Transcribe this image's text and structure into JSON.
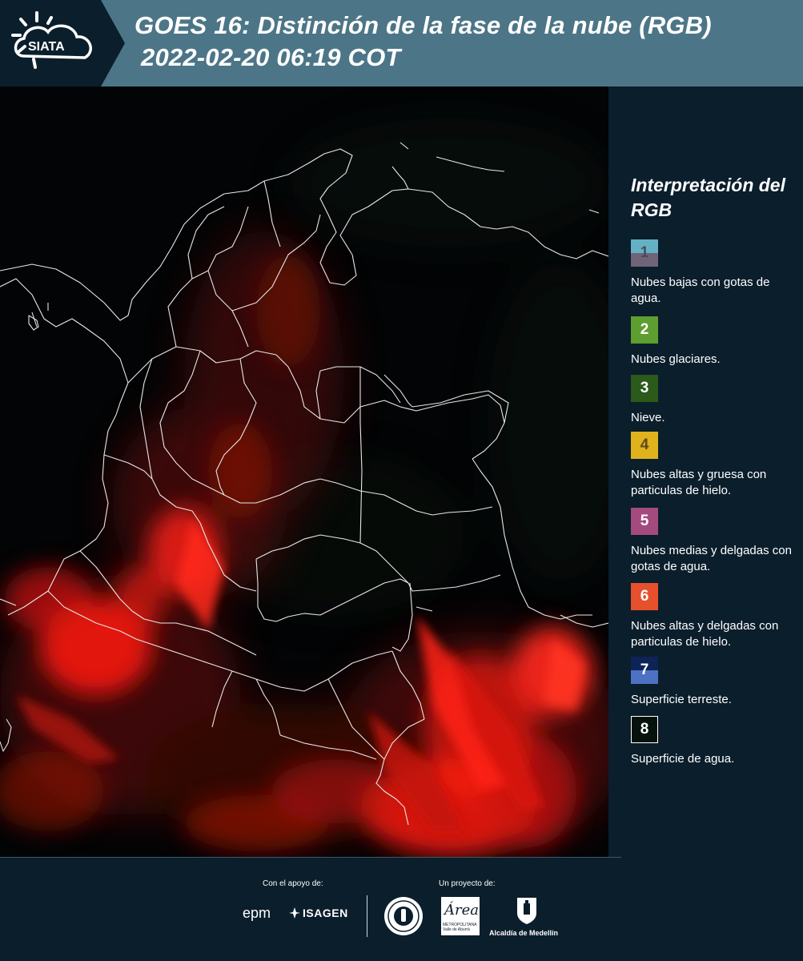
{
  "header": {
    "brand": "SIATA",
    "title_line1": "GOES 16: Distinción de la fase de la nube (RGB)",
    "title_line2": "2022-02-20 06:19 COT"
  },
  "legend": {
    "title": "Interpretación del RGB",
    "items": [
      {
        "number": "1",
        "label": "Nubes bajas con gotas de agua.",
        "color_top": "#62b2c4",
        "color_bottom": "#6f6478",
        "text_color": "#4b4b5a"
      },
      {
        "number": "2",
        "label": "Nubes glaciares.",
        "color_top": "#5e9d2f",
        "color_bottom": "#5e9d2f",
        "text_color": "#ffffff"
      },
      {
        "number": "3",
        "label": "Nieve.",
        "color_top": "#2b5a1b",
        "color_bottom": "#2b5a1b",
        "text_color": "#ffffff"
      },
      {
        "number": "4",
        "label": "Nubes altas y gruesa con particulas de hielo.",
        "color_top": "#e0b21c",
        "color_bottom": "#e0b21c",
        "text_color": "#5b4a20"
      },
      {
        "number": "5",
        "label": "Nubes medias y delgadas con gotas de agua.",
        "color_top": "#a34b7f",
        "color_bottom": "#a34b7f",
        "text_color": "#ffffff"
      },
      {
        "number": "6",
        "label": "Nubes altas y delgadas con particulas de hielo.",
        "color_top": "#e7502d",
        "color_bottom": "#e7502d",
        "text_color": "#ffffff"
      },
      {
        "number": "7",
        "label": "Superficie terreste.",
        "color_top": "#0e2456",
        "color_bottom": "#4d72c4",
        "text_color": "#ffffff"
      },
      {
        "number": "8",
        "label": "Superficie de agua.",
        "color_top": "#06120c",
        "color_bottom": "#06120c",
        "text_color": "#ffffff"
      }
    ]
  },
  "footer": {
    "support_caption": "Con el apoyo de:",
    "project_caption": "Un proyecto de:",
    "sponsor_1": "epm",
    "sponsor_2": "ISAGEN",
    "partner_area": "Área",
    "partner_area_sub": "METROPOLITANA Valle de Aburrá",
    "partner_alcaldia": "Alcaldía de Medellín"
  },
  "colors": {
    "header_bg": "#4c7687",
    "panel_bg": "#0b1e2c",
    "cloud_red": "#ff1a12",
    "border_line": "#e8e8e8"
  }
}
